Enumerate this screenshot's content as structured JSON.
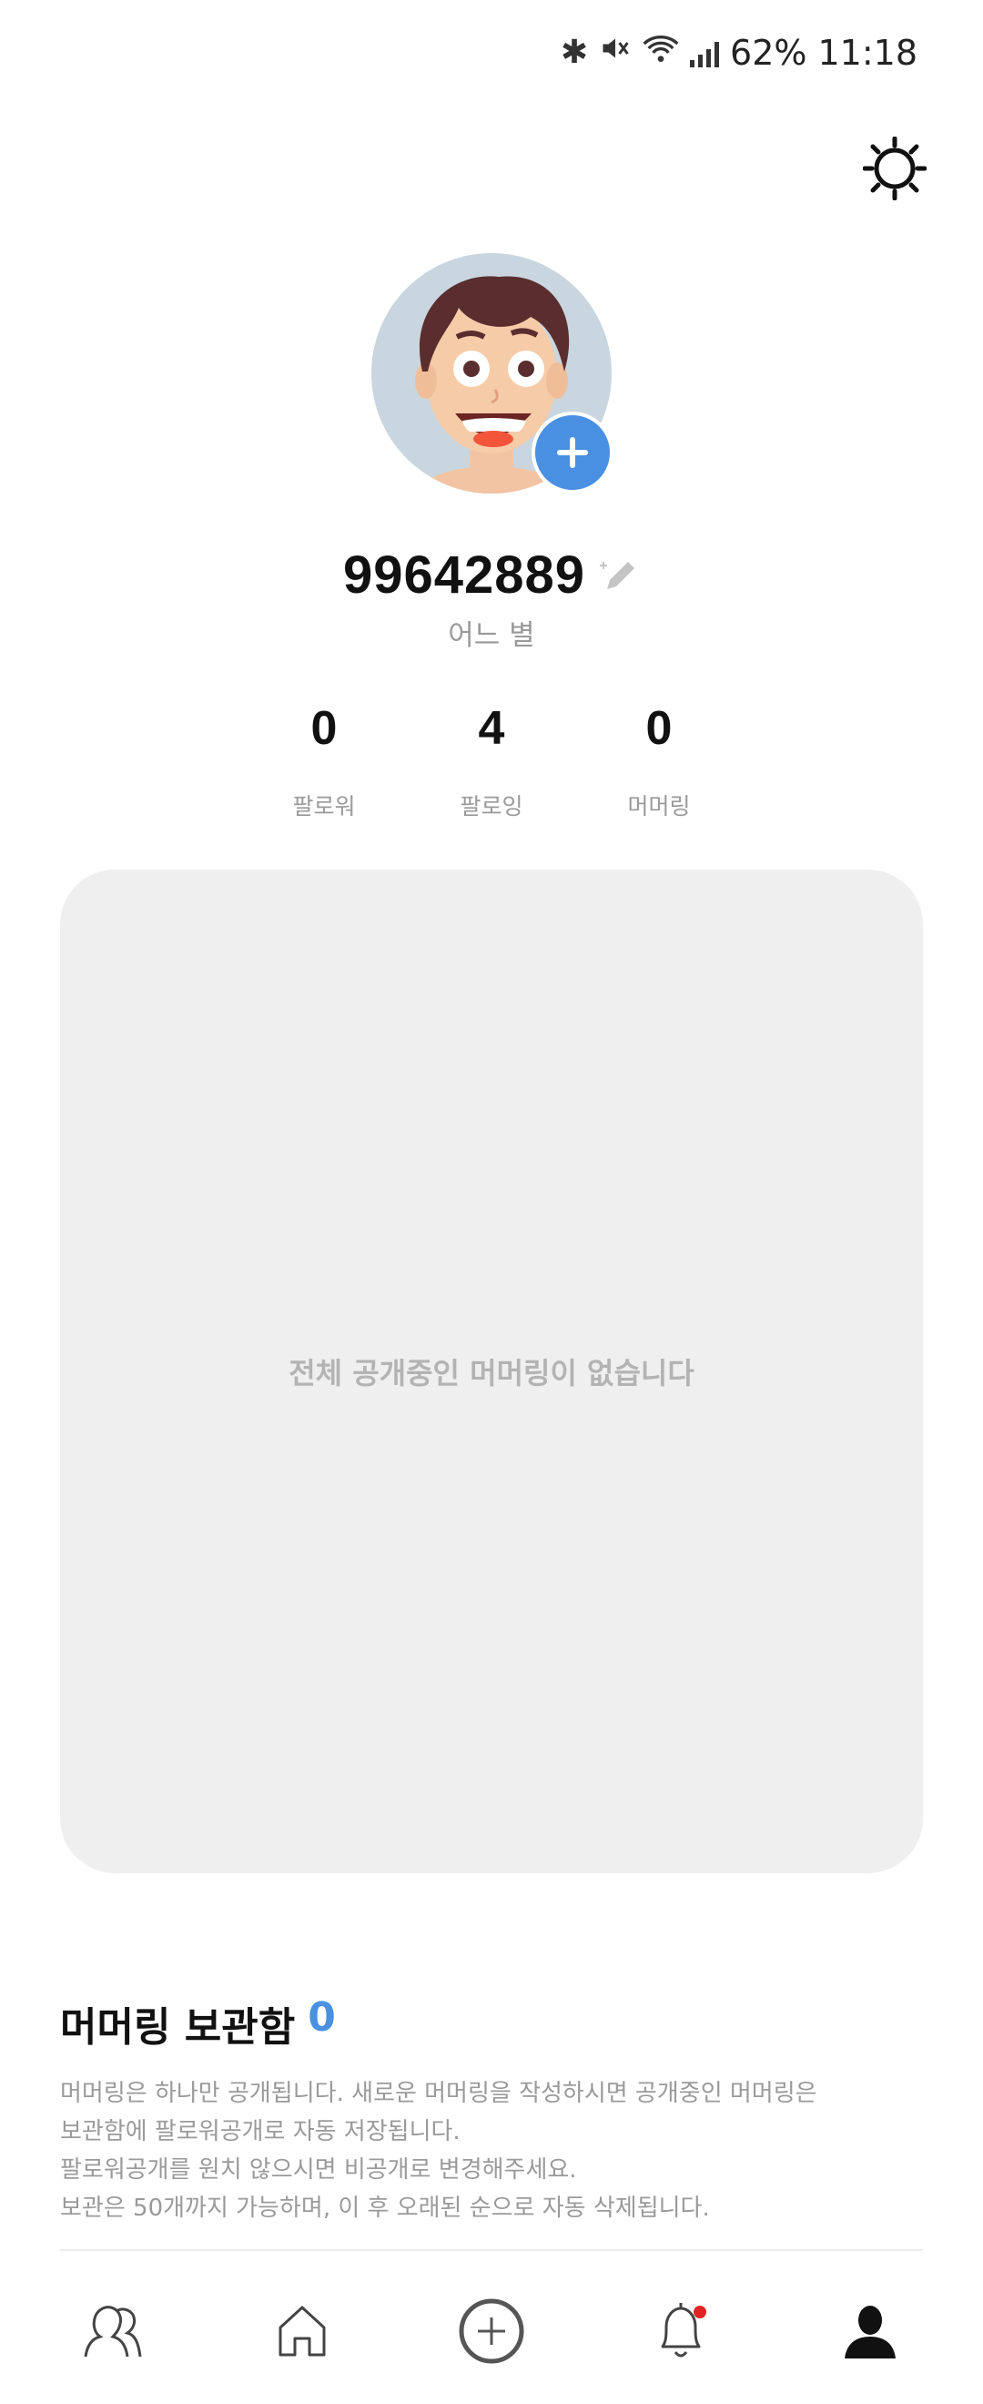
{
  "status_bar": {
    "battery": "62%",
    "time": "11:18",
    "icons": [
      "bluetooth-icon",
      "mute-icon",
      "wifi-icon",
      "signal-icon"
    ]
  },
  "profile": {
    "username": "99642889",
    "subtitle": "어느 별",
    "avatar_bg": "#c9d6df",
    "accent": "#4a90e2"
  },
  "stats": [
    {
      "value": "0",
      "label": "팔로워"
    },
    {
      "value": "4",
      "label": "팔로잉"
    },
    {
      "value": "0",
      "label": "머머링"
    }
  ],
  "feed": {
    "empty_message": "전체 공개중인 머머링이 없습니다"
  },
  "storage": {
    "title": "머머링 보관함",
    "count": "0",
    "desc_lines": [
      "머머링은 하나만 공개됩니다. 새로운 머머링을 작성하시면 공개중인 머머링은",
      "보관함에 팔로워공개로 자동 저장됩니다.",
      "팔로워공개를 원치 않으시면 비공개로 변경해주세요.",
      "보관은 50개까지 가능하며, 이 후 오래된 순으로 자동 삭제됩니다."
    ]
  },
  "bottom_nav": [
    {
      "icon": "friends-icon",
      "active": false
    },
    {
      "icon": "home-icon",
      "active": false
    },
    {
      "icon": "add-circle-icon",
      "active": false
    },
    {
      "icon": "bell-icon",
      "active": false,
      "badge": true
    },
    {
      "icon": "profile-icon",
      "active": true
    }
  ]
}
